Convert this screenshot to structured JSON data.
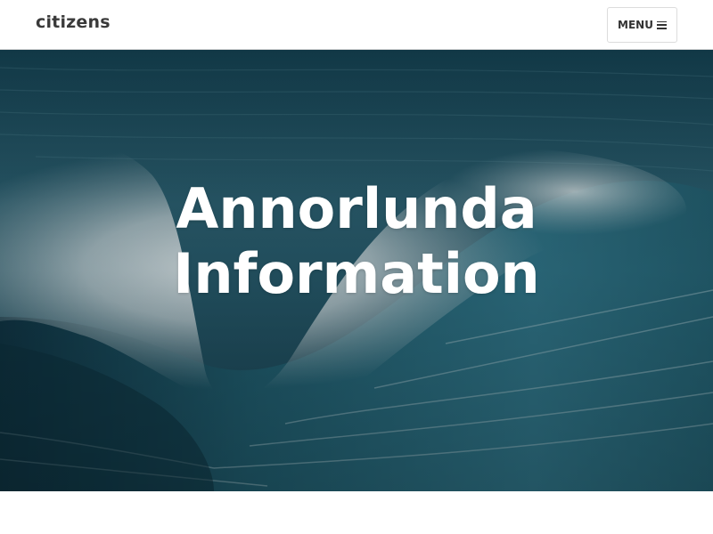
{
  "header": {
    "brand": "citizens",
    "menu_label": "MENU",
    "menu_icon": "hamburger-icon"
  },
  "hero": {
    "title_line1": "Annorlunda",
    "title_line2": "Information",
    "background": "ocean-wave-image"
  },
  "colors": {
    "brand_text": "#3a3a3a",
    "hero_text": "#ffffff",
    "header_bg": "#ffffff",
    "ocean_dark": "#123946",
    "ocean_mid": "#2a6477",
    "foam": "#d4dde0"
  }
}
